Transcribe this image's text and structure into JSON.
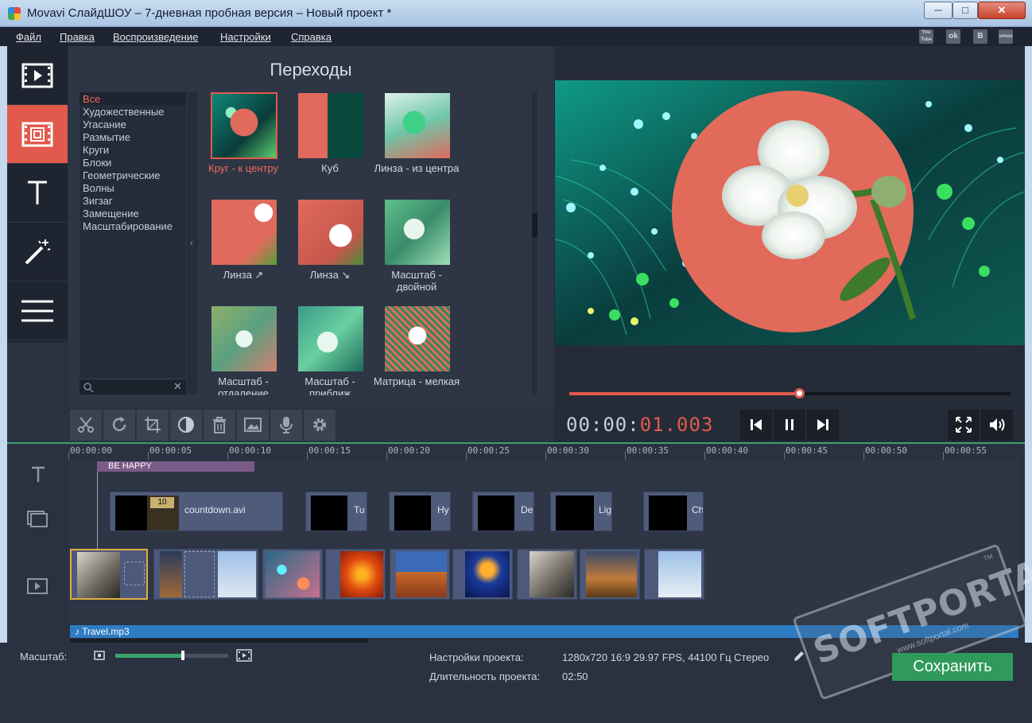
{
  "window": {
    "title": "Movavi СлайдШОУ – 7-дневная пробная версия – Новый проект *",
    "minimize": "─",
    "maximize": "□",
    "close": "✕"
  },
  "menu": [
    "Файл",
    "Правка",
    "Воспроизведение",
    "Настройки",
    "Справка"
  ],
  "social": [
    "You Tube",
    "ok",
    "B",
    "vimeo"
  ],
  "sidebar": [
    {
      "name": "media-icon"
    },
    {
      "name": "transitions-icon",
      "active": true
    },
    {
      "name": "text-icon"
    },
    {
      "name": "effects-wand-icon"
    },
    {
      "name": "more-menu-icon"
    }
  ],
  "transitions": {
    "title": "Переходы",
    "categories": [
      "Все",
      "Художественные",
      "Угасание",
      "Размытие",
      "Круги",
      "Блоки",
      "Геометрические",
      "Волны",
      "Зигзаг",
      "Замещение",
      "Масштабирование"
    ],
    "selected_category": "Все",
    "collapse_glyph": "‹",
    "search_clear": "✕",
    "items": [
      {
        "label": "Круг - к центру",
        "selected": true
      },
      {
        "label": "Куб"
      },
      {
        "label": "Линза - из центра"
      },
      {
        "label": "Линза ↗"
      },
      {
        "label": "Линза ↘"
      },
      {
        "label": "Масштаб - двойной"
      },
      {
        "label": "Масштаб - отдаление"
      },
      {
        "label": "Масштаб - приближ"
      },
      {
        "label": "Матрица - мелкая"
      }
    ]
  },
  "toolbar": [
    "cut-icon",
    "rotate-icon",
    "crop-icon",
    "color-adjust-icon",
    "delete-icon",
    "image-icon",
    "microphone-icon",
    "settings-gear-icon"
  ],
  "player": {
    "timecode_dim": "00:00:",
    "timecode_lit": "01.003",
    "progress": 0.52
  },
  "timeline": {
    "ticks": [
      "00:00:00",
      "00:00:05",
      "00:00:10",
      "00:00:15",
      "00:00:20",
      "00:00:25",
      "00:00:30",
      "00:00:35",
      "00:00:40",
      "00:00:45",
      "00:00:50",
      "00:00:55"
    ],
    "title_clip": "BE HAPPY",
    "countdown_badge": "10",
    "video_clips": [
      "countdown.avi",
      "Tu",
      "Hy",
      "De",
      "Lig",
      "Ch"
    ],
    "audio": "♪  Travel.mp3"
  },
  "bottom": {
    "scale_label": "Масштаб:",
    "scale_value": 0.6,
    "settings_label": "Настройки проекта:",
    "settings_value": "1280x720 16:9 29.97 FPS, 44100 Гц Стерео",
    "duration_label": "Длительность проекта:",
    "duration_value": "02:50",
    "save": "Сохранить"
  },
  "watermark": {
    "brand": "SOFTPORTAL",
    "tm": "TM",
    "url": "www.softportal.com"
  },
  "colors": {
    "accent": "#e15a4b",
    "green": "#2f9a5a",
    "panel": "#2e3645"
  }
}
